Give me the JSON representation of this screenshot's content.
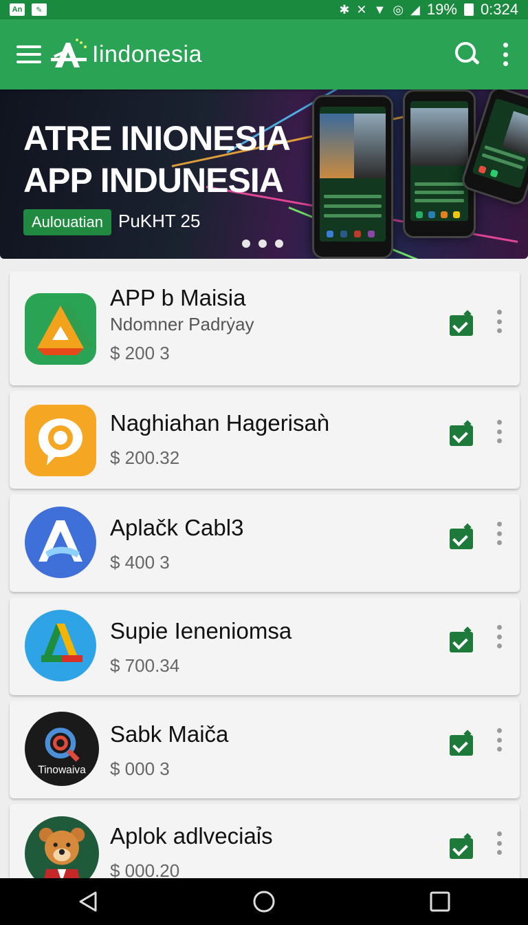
{
  "status_bar": {
    "left_icons": [
      "notification-icon",
      "edit-icon"
    ],
    "left_box_text": "An",
    "battery_percent": "19%",
    "time": "0:324"
  },
  "app_bar": {
    "title": "Iindonesia"
  },
  "banner": {
    "line1": "ATRE INIONESIA",
    "line2": "APP INDUNESIA",
    "badge": "Aulouatian",
    "subtitle": "PuKHT 25",
    "dots_count": 3
  },
  "apps": [
    {
      "name": "APP b Maisia",
      "developer": "Ndomner Padrẏay",
      "price": "$ 200 3",
      "icon": "drive-triangle-icon",
      "installed": true
    },
    {
      "name": "Naghiahan Hagerisaǹ",
      "developer": "",
      "price": "$ 200.32",
      "icon": "orange-chat-icon",
      "installed": true
    },
    {
      "name": "Aplačk Cabl3",
      "developer": "",
      "price": "$ 400 3",
      "icon": "blue-a-icon",
      "installed": true
    },
    {
      "name": "Supie Ieneniomsa",
      "developer": "",
      "price": "$ 700.34",
      "icon": "google-a-icon",
      "installed": true
    },
    {
      "name": "Sabk Maiča",
      "developer": "",
      "price": "$ 000 3",
      "icon": "search-circle-icon",
      "icon_text": "Tinowaiva",
      "installed": true
    },
    {
      "name": "Aplok adlveciaỉs",
      "developer": "",
      "price": "$ 000.20",
      "icon": "bear-mascot-icon",
      "installed": true
    }
  ],
  "colors": {
    "status_bar": "#1a8a3f",
    "app_bar": "#2aa454",
    "check": "#1e7a3a"
  }
}
